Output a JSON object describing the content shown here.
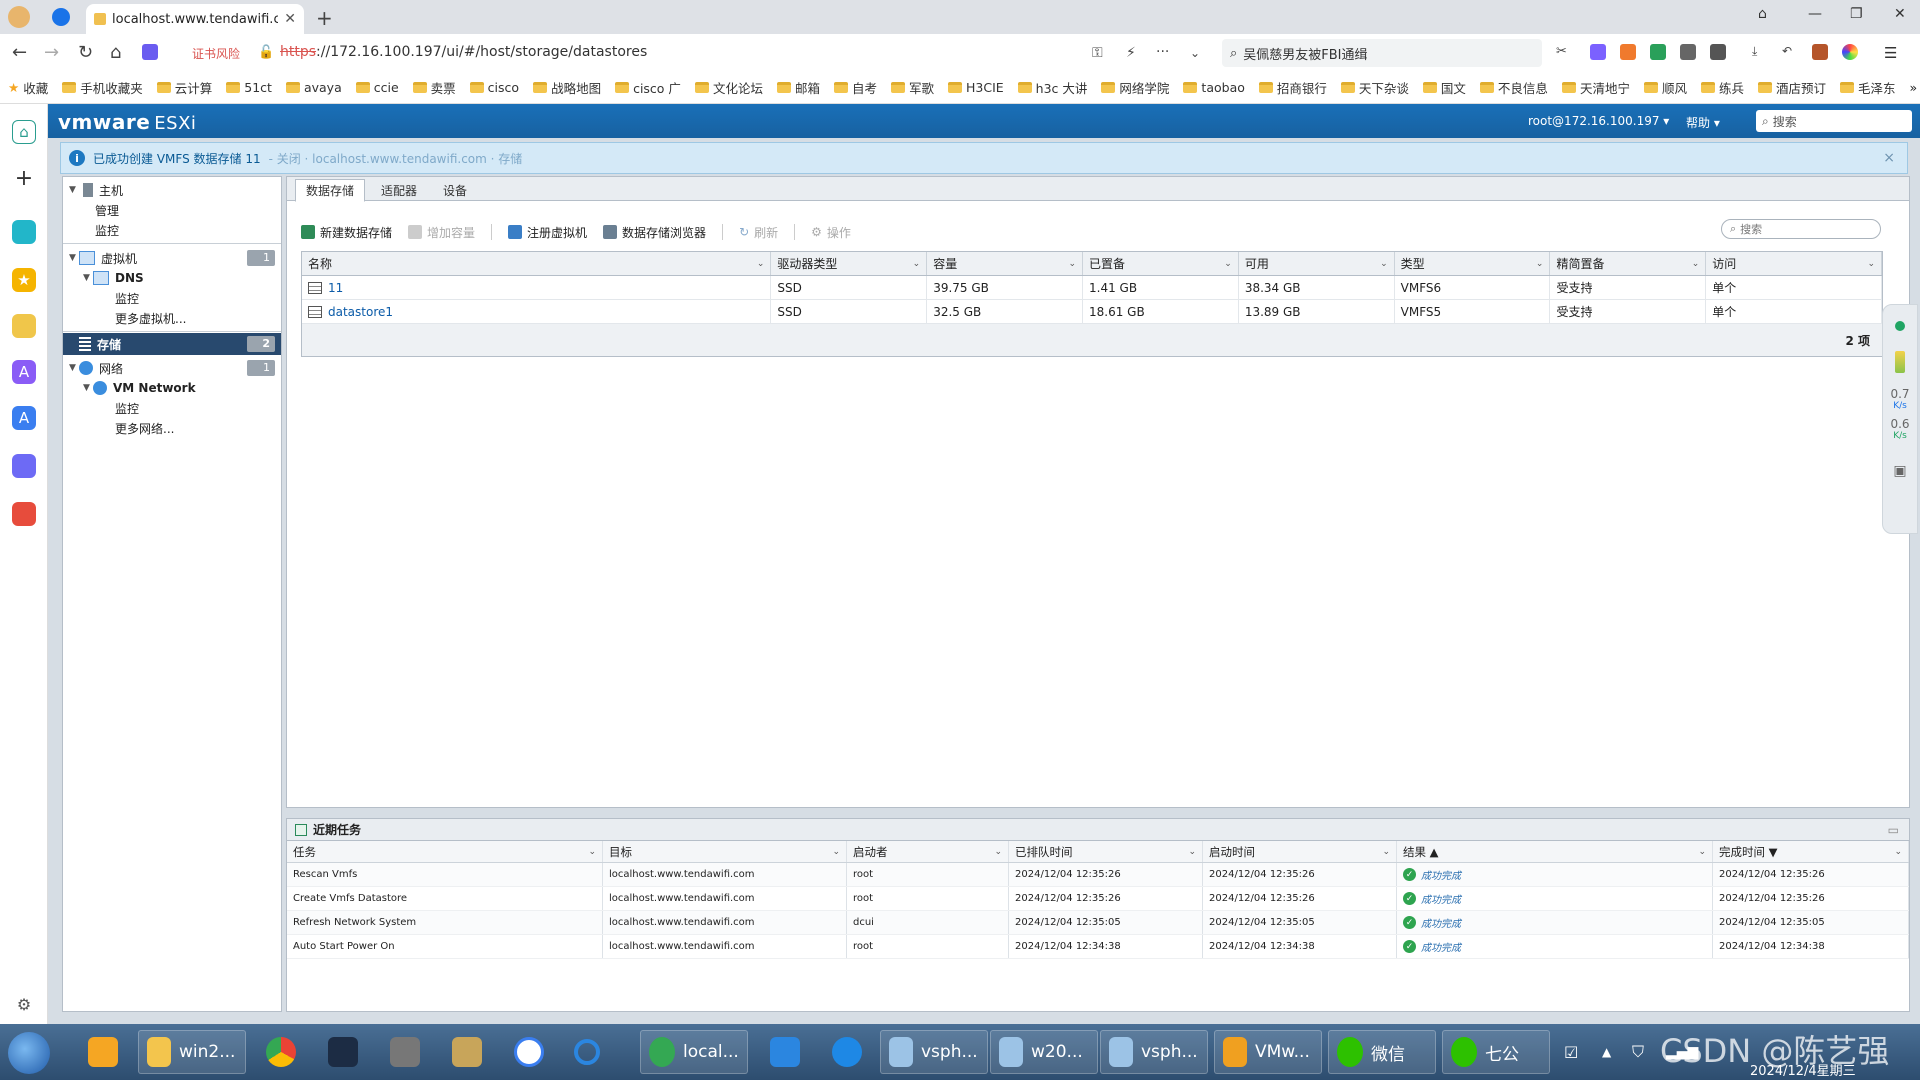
{
  "browser": {
    "tab_title": "localhost.www.tendawifi.cor",
    "cert_warning": "证书风险",
    "url_https": "https",
    "url_rest": "://172.16.100.197/ui/#/host/storage/datastores",
    "search_text": "吴佩慈男友被FBI通缉",
    "bookmarks": [
      "收藏",
      "手机收藏夹",
      "云计算",
      "51ct",
      "avaya",
      "ccie",
      "卖票",
      "cisco",
      "战略地图",
      "cisco 广",
      "文化论坛",
      "邮箱",
      "自考",
      "军歌",
      "H3CIE",
      "h3c 大讲",
      "网络学院",
      "taobao",
      "招商银行",
      "天下杂谈",
      "国文",
      "不良信息",
      "天清地宁",
      "顺风",
      "练兵",
      "酒店预订",
      "毛泽东"
    ],
    "bookmarks_more": "»"
  },
  "esxi": {
    "logo_vm": "vmware",
    "logo_esx": "ESXi",
    "user": "root@172.16.100.197 ▾",
    "help": "帮助 ▾",
    "search_placeholder": "搜索",
    "notice_text": "已成功创建 VMFS 数据存储 11",
    "notice_faded": " - 关闭 · localhost.www.tendawifi.com · 存储",
    "close": "×"
  },
  "navigator": {
    "host": "主机",
    "manage": "管理",
    "monitor": "监控",
    "vms": "虚拟机",
    "vms_count": "1",
    "dns": "DNS",
    "dns_monitor": "监控",
    "more_vms": "更多虚拟机...",
    "storage": "存储",
    "storage_count": "2",
    "network": "网络",
    "network_count": "1",
    "vm_network": "VM Network",
    "net_monitor": "监控",
    "more_networks": "更多网络..."
  },
  "tabs": [
    "数据存储",
    "适配器",
    "设备"
  ],
  "toolbar": {
    "new_ds": "新建数据存储",
    "increase": "增加容量",
    "register_vm": "注册虚拟机",
    "browser": "数据存储浏览器",
    "refresh": "刷新",
    "actions": "操作",
    "search_placeholder": "搜索"
  },
  "datastore_table": {
    "columns": [
      "名称",
      "驱动器类型",
      "容量",
      "已置备",
      "可用",
      "类型",
      "精简置备",
      "访问"
    ],
    "rows": [
      [
        "11",
        "SSD",
        "39.75 GB",
        "1.41 GB",
        "38.34 GB",
        "VMFS6",
        "受支持",
        "单个"
      ],
      [
        "datastore1",
        "SSD",
        "32.5 GB",
        "18.61 GB",
        "13.89 GB",
        "VMFS5",
        "受支持",
        "单个"
      ]
    ],
    "footer": "2 项"
  },
  "recent_tasks": {
    "title": "近期任务",
    "columns": [
      "任务",
      "目标",
      "启动者",
      "已排队时间",
      "启动时间",
      "结果 ▲",
      "完成时间 ▼"
    ],
    "rows": [
      [
        "Rescan Vmfs",
        "localhost.www.tendawifi.com",
        "root",
        "2024/12/04 12:35:26",
        "2024/12/04 12:35:26",
        "成功完成",
        "2024/12/04 12:35:26"
      ],
      [
        "Create Vmfs Datastore",
        "localhost.www.tendawifi.com",
        "root",
        "2024/12/04 12:35:26",
        "2024/12/04 12:35:26",
        "成功完成",
        "2024/12/04 12:35:26"
      ],
      [
        "Refresh Network System",
        "localhost.www.tendawifi.com",
        "dcui",
        "2024/12/04 12:35:05",
        "2024/12/04 12:35:05",
        "成功完成",
        "2024/12/04 12:35:05"
      ],
      [
        "Auto Start Power On",
        "localhost.www.tendawifi.com",
        "root",
        "2024/12/04 12:34:38",
        "2024/12/04 12:34:38",
        "成功完成",
        "2024/12/04 12:34:38"
      ]
    ]
  },
  "widget": {
    "up_value": "0.7",
    "up_unit": "K/s",
    "down_value": "0.6",
    "down_unit": "K/s"
  },
  "taskbar": {
    "items": [
      "win2...",
      "local...",
      "vsph...",
      "w20...",
      "vsph...",
      "VMw...",
      "微信",
      "七公"
    ],
    "date": "2024/12/4星期三"
  },
  "watermark": "CSDN @陈艺强",
  "colors": {
    "esxi_header": "#1761a1",
    "selected_nav": "#28496e",
    "notice_bg": "#d4e9f7",
    "success": "#2ea44f"
  }
}
